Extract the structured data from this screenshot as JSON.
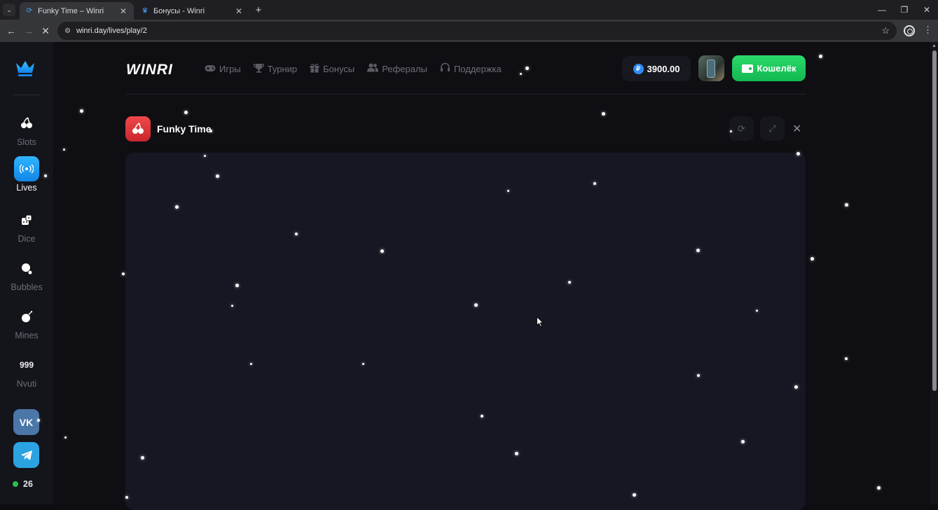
{
  "browser": {
    "tabs": [
      {
        "title": "Funky Time – Winri",
        "active": true
      },
      {
        "title": "Бонусы - Winri",
        "active": false
      }
    ],
    "url": "winri.day/lives/play/2"
  },
  "sidebar": {
    "items": [
      {
        "label": "Slots",
        "icon": "cherries-icon",
        "glyph": "🍒",
        "active": false
      },
      {
        "label": "Lives",
        "icon": "broadcast-icon",
        "glyph": "((•))",
        "active": true
      },
      {
        "label": "Dice",
        "icon": "dice-icon",
        "glyph": "⚅",
        "active": false
      },
      {
        "label": "Bubbles",
        "icon": "bubbles-icon",
        "glyph": "●",
        "active": false
      },
      {
        "label": "Mines",
        "icon": "bomb-icon",
        "glyph": "💣",
        "active": false
      },
      {
        "label": "Nvuti",
        "icon": "nvuti-icon",
        "glyph": "999",
        "active": false
      }
    ],
    "socials": [
      {
        "label": "VK",
        "color": "#4a76a8"
      },
      {
        "label": "➤",
        "color": "#2aa3e0"
      }
    ],
    "online_count": "26"
  },
  "header": {
    "brand": "WINRI",
    "nav": [
      {
        "label": "Игры",
        "icon": "gamepad-icon",
        "glyph": "🎮"
      },
      {
        "label": "Турнир",
        "icon": "trophy-icon",
        "glyph": "🏆"
      },
      {
        "label": "Бонусы",
        "icon": "gift-icon",
        "glyph": "🎁"
      },
      {
        "label": "Рефералы",
        "icon": "users-icon",
        "glyph": "👥"
      },
      {
        "label": "Поддержка",
        "icon": "headset-icon",
        "glyph": "🎧"
      }
    ],
    "balance": "3900.00",
    "currency_symbol": "₽",
    "wallet_label": "Кошелёк"
  },
  "game": {
    "title": "Funky Time",
    "icon": "cherries-icon"
  },
  "colors": {
    "accent_blue": "#1aa0f5",
    "wallet_green": "#16c45a",
    "game_icon_red": "#e0383c"
  }
}
